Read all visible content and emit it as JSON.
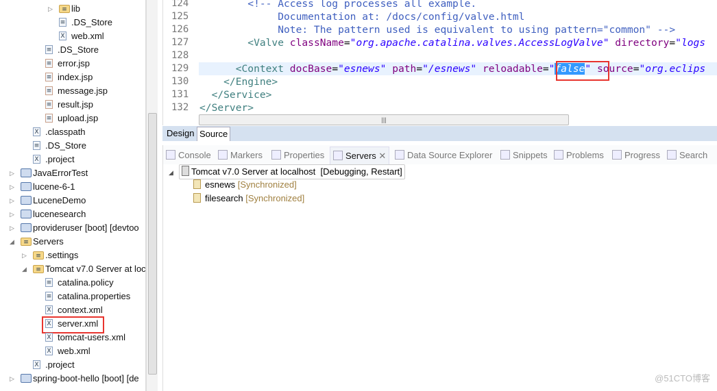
{
  "tree": {
    "items": [
      {
        "label": "lib",
        "icon": "folder-icon",
        "depth": 3,
        "arrow": "collapsed"
      },
      {
        "label": ".DS_Store",
        "icon": "text-file-icon",
        "depth": 3
      },
      {
        "label": "web.xml",
        "icon": "xml-file-icon",
        "depth": 3
      },
      {
        "label": ".DS_Store",
        "icon": "text-file-icon",
        "depth": 2
      },
      {
        "label": "error.jsp",
        "icon": "jsp-file-icon",
        "depth": 2
      },
      {
        "label": "index.jsp",
        "icon": "jsp-file-icon",
        "depth": 2
      },
      {
        "label": "message.jsp",
        "icon": "jsp-file-icon",
        "depth": 2
      },
      {
        "label": "result.jsp",
        "icon": "jsp-file-icon",
        "depth": 2
      },
      {
        "label": "upload.jsp",
        "icon": "jsp-file-icon",
        "depth": 2
      },
      {
        "label": ".classpath",
        "icon": "xml-file-icon",
        "depth": 1
      },
      {
        "label": ".DS_Store",
        "icon": "text-file-icon",
        "depth": 1
      },
      {
        "label": ".project",
        "icon": "xml-file-icon",
        "depth": 1
      },
      {
        "label": "JavaErrorTest",
        "icon": "project-icon",
        "depth": 0,
        "arrow": "collapsed"
      },
      {
        "label": "lucene-6-1",
        "icon": "project-icon",
        "depth": 0,
        "arrow": "collapsed"
      },
      {
        "label": "LuceneDemo",
        "icon": "project-icon",
        "depth": 0,
        "arrow": "collapsed"
      },
      {
        "label": "lucenesearch",
        "icon": "project-icon",
        "depth": 0,
        "arrow": "collapsed"
      },
      {
        "label": "provideruser [boot] [devtoo",
        "icon": "project-icon",
        "depth": 0,
        "arrow": "collapsed"
      },
      {
        "label": "Servers",
        "icon": "folder-icon",
        "depth": 0,
        "arrow": "expanded"
      },
      {
        "label": ".settings",
        "icon": "folder-icon",
        "depth": 1,
        "arrow": "collapsed"
      },
      {
        "label": "Tomcat v7.0 Server at loc",
        "icon": "folder-icon",
        "depth": 1,
        "arrow": "expanded"
      },
      {
        "label": "catalina.policy",
        "icon": "text-file-icon",
        "depth": 2
      },
      {
        "label": "catalina.properties",
        "icon": "text-file-icon",
        "depth": 2
      },
      {
        "label": "context.xml",
        "icon": "xml-file-icon",
        "depth": 2
      },
      {
        "label": "server.xml",
        "icon": "xml-file-icon",
        "depth": 2,
        "highlighted": true
      },
      {
        "label": "tomcat-users.xml",
        "icon": "xml-file-icon",
        "depth": 2
      },
      {
        "label": "web.xml",
        "icon": "xml-file-icon",
        "depth": 2
      },
      {
        "label": ".project",
        "icon": "xml-file-icon",
        "depth": 1
      },
      {
        "label": "spring-boot-hello [boot] [de",
        "icon": "project-icon",
        "depth": 0,
        "arrow": "collapsed"
      }
    ]
  },
  "editor": {
    "lines": [
      {
        "n": "124",
        "segs": [
          [
            "cm",
            "        <!-- Access log processes all example."
          ]
        ]
      },
      {
        "n": "125",
        "segs": [
          [
            "cm",
            "             Documentation at: /docs/config/valve.html"
          ]
        ]
      },
      {
        "n": "126",
        "segs": [
          [
            "cm",
            "             Note: The pattern used is equivalent to using pattern=\"common\" -->"
          ]
        ]
      },
      {
        "n": "127",
        "segs": [
          [
            "tg",
            "        <Valve "
          ],
          [
            "at",
            "className"
          ],
          [
            "",
            "="
          ],
          [
            "vl",
            "\"org.apache.catalina.valves.AccessLogValve\""
          ],
          [
            "at",
            " directory"
          ],
          [
            "",
            "="
          ],
          [
            "vl",
            "\"logs"
          ]
        ]
      },
      {
        "n": "128",
        "segs": []
      },
      {
        "n": "129",
        "segs": [
          [
            "tg",
            "      <Context "
          ],
          [
            "at",
            "docBase"
          ],
          [
            "",
            "="
          ],
          [
            "vl",
            "\"esnews\""
          ],
          [
            "at",
            " path"
          ],
          [
            "",
            "="
          ],
          [
            "vl",
            "\"/esnews\""
          ],
          [
            "at",
            " reloadable"
          ],
          [
            "",
            "="
          ],
          [
            "vl",
            "\""
          ],
          [
            "vl sel",
            "false"
          ],
          [
            "vl",
            "\""
          ],
          [
            "at",
            " source"
          ],
          [
            "",
            "="
          ],
          [
            "vl",
            "\"org.eclips"
          ]
        ]
      },
      {
        "n": "130",
        "segs": [
          [
            "tg",
            "    </Engine>"
          ]
        ]
      },
      {
        "n": "131",
        "segs": [
          [
            "tg",
            "  </Service>"
          ]
        ]
      },
      {
        "n": "132",
        "segs": [
          [
            "tg",
            "</Server>"
          ]
        ]
      }
    ],
    "tabs": [
      "Design",
      "Source"
    ],
    "active_tab": "Source"
  },
  "views": {
    "tabs": [
      {
        "label": "Console",
        "icon": "console-icon"
      },
      {
        "label": "Markers",
        "icon": "markers-icon"
      },
      {
        "label": "Properties",
        "icon": "properties-icon"
      },
      {
        "label": "Servers",
        "icon": "servers-icon",
        "active": true
      },
      {
        "label": "Data Source Explorer",
        "icon": "data-source-icon"
      },
      {
        "label": "Snippets",
        "icon": "snippets-icon"
      },
      {
        "label": "Problems",
        "icon": "problems-icon"
      },
      {
        "label": "Progress",
        "icon": "progress-icon"
      },
      {
        "label": "Search",
        "icon": "search-icon"
      }
    ],
    "server": {
      "name": "Tomcat v7.0 Server at localhost",
      "state": "[Debugging, Restart]",
      "modules": [
        {
          "name": "esnews",
          "status": "[Synchronized]"
        },
        {
          "name": "filesearch",
          "status": "[Synchronized]"
        }
      ]
    }
  },
  "watermark": "@51CTO博客",
  "colors": {
    "highlight": "#e8342e",
    "selection": "#3399ff"
  }
}
